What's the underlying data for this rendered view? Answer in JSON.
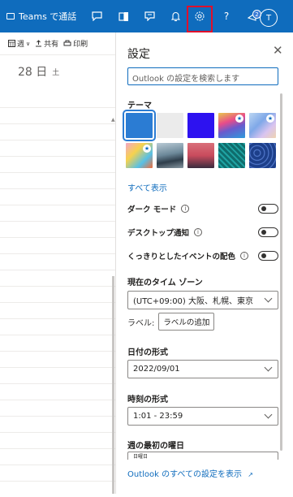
{
  "topbar": {
    "teams_label": "Teams で通話",
    "notification_count": "2",
    "avatar_initial": "T",
    "icons": [
      "teams-call-icon",
      "chat-icon",
      "office-icon",
      "feedback-icon",
      "bell-icon",
      "settings-gear-icon",
      "help-icon",
      "whats-new-icon"
    ],
    "highlight_color": "#e0102b",
    "background_color": "#0f6cbd"
  },
  "calendar": {
    "toolbar": {
      "week_label": "週",
      "share_label": "共有",
      "print_label": "印刷"
    },
    "date": "28 日",
    "day_of_week": "土"
  },
  "settings": {
    "title": "設定",
    "search_placeholder": "Outlook の設定を検索します",
    "theme_label": "テーマ",
    "themes": [
      {
        "name": "blue",
        "selected": true
      },
      {
        "name": "light-gray"
      },
      {
        "name": "indigo"
      },
      {
        "name": "rainbow-image",
        "starred": true
      },
      {
        "name": "wave-image",
        "starred": true
      },
      {
        "name": "palette-image",
        "starred": true
      },
      {
        "name": "mountain-image"
      },
      {
        "name": "sunset-image"
      },
      {
        "name": "circuit-image"
      },
      {
        "name": "blueprint-image"
      }
    ],
    "show_all_label": "すべて表示",
    "dark_mode_label": "ダーク モード",
    "desktop_notifications_label": "デスクトップ通知",
    "high_contrast_events_label": "くっきりとしたイベントの配色",
    "timezone_label": "現在のタイム ゾーン",
    "timezone_value": "(UTC+09:00) 大阪、札幌、東京",
    "label_prefix": "ラベル:",
    "add_label_button": "ラベルの追加",
    "date_format_label": "日付の形式",
    "date_format_value": "2022/09/01",
    "time_format_label": "時刻の形式",
    "time_format_value": "1:01 - 23:59",
    "first_day_label": "週の最初の曜日",
    "first_day_value": "日曜日",
    "all_settings_link": "Outlook のすべての設定を表示",
    "accent_color": "#0f6cbd"
  }
}
